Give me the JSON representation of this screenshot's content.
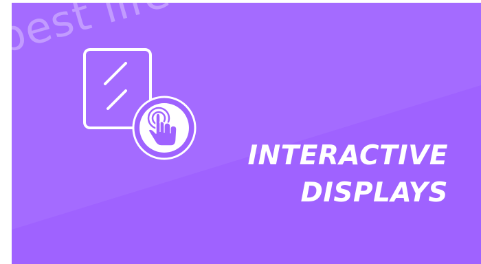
{
  "banner": {
    "background_color": "#9f62ff",
    "watermark_text": "best life",
    "headline_line1": "INTERACTIVE",
    "headline_line2": "DISPLAYS",
    "icon_name": "touchscreen-tap-icon"
  }
}
